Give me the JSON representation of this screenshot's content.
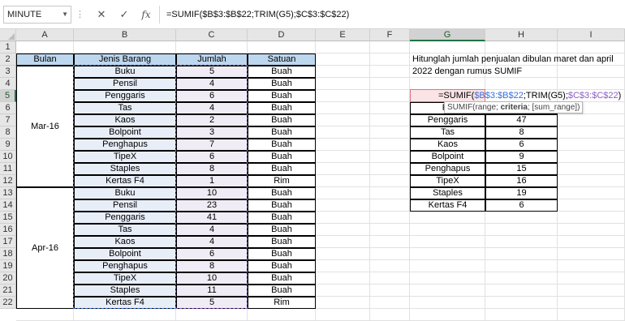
{
  "formula_bar": {
    "name_box": "MINUTE",
    "cancel_icon": "✕",
    "enter_icon": "✓",
    "fx_icon": "fx",
    "formula": "=SUMIF($B$3:$B$22;TRIM(G5);$C$3:$C$22)"
  },
  "columns": [
    "A",
    "B",
    "C",
    "D",
    "E",
    "F",
    "G",
    "H",
    "I"
  ],
  "rows": [
    "1",
    "2",
    "3",
    "4",
    "5",
    "6",
    "7",
    "8",
    "9",
    "10",
    "11",
    "12",
    "13",
    "14",
    "15",
    "16",
    "17",
    "18",
    "19",
    "20",
    "21",
    "22"
  ],
  "table": {
    "headers": [
      "Bulan",
      "Jenis Barang",
      "Jumlah",
      "Satuan"
    ],
    "month_groups": [
      "Mar-16",
      "Apr-16"
    ],
    "items": [
      "Buku",
      "Pensil",
      "Penggaris",
      "Tas",
      "Kaos",
      "Bolpoint",
      "Penghapus",
      "TipeX",
      "Staples",
      "Kertas F4",
      "Buku",
      "Pensil",
      "Penggaris",
      "Tas",
      "Kaos",
      "Bolpoint",
      "Penghapus",
      "TipeX",
      "Staples",
      "Kertas F4"
    ],
    "quantities": [
      "5",
      "4",
      "6",
      "4",
      "2",
      "3",
      "7",
      "6",
      "8",
      "1",
      "10",
      "23",
      "41",
      "4",
      "4",
      "6",
      "8",
      "10",
      "11",
      "5"
    ],
    "units": [
      "Buah",
      "Buah",
      "Buah",
      "Buah",
      "Buah",
      "Buah",
      "Buah",
      "Buah",
      "Buah",
      "Rim",
      "Buah",
      "Buah",
      "Buah",
      "Buah",
      "Buah",
      "Buah",
      "Buah",
      "Buah",
      "Buah",
      "Rim"
    ]
  },
  "instruction": {
    "line1": "Hitunglah jumlah penjualan dibulan maret dan april",
    "line2": "2022 dengan rumus SUMIF"
  },
  "summary": {
    "g6_partial": "Pe",
    "items": [
      "Penggaris",
      "Tas",
      "Kaos",
      "Bolpoint",
      "Penghapus",
      "TipeX",
      "Staples",
      "Kertas F4"
    ],
    "totals": [
      "47",
      "8",
      "6",
      "9",
      "15",
      "16",
      "19",
      "6"
    ]
  },
  "editing": {
    "part1": "=SUMIF(",
    "part2": "$B$3:$B$22",
    "part3": ";TRIM(G5);",
    "part4": "$C$3:$C$22",
    "part5": ")",
    "tooltip_prefix": "SUMIF(range; ",
    "tooltip_bold": "criteria",
    "tooltip_suffix": "; [sum_range])"
  }
}
